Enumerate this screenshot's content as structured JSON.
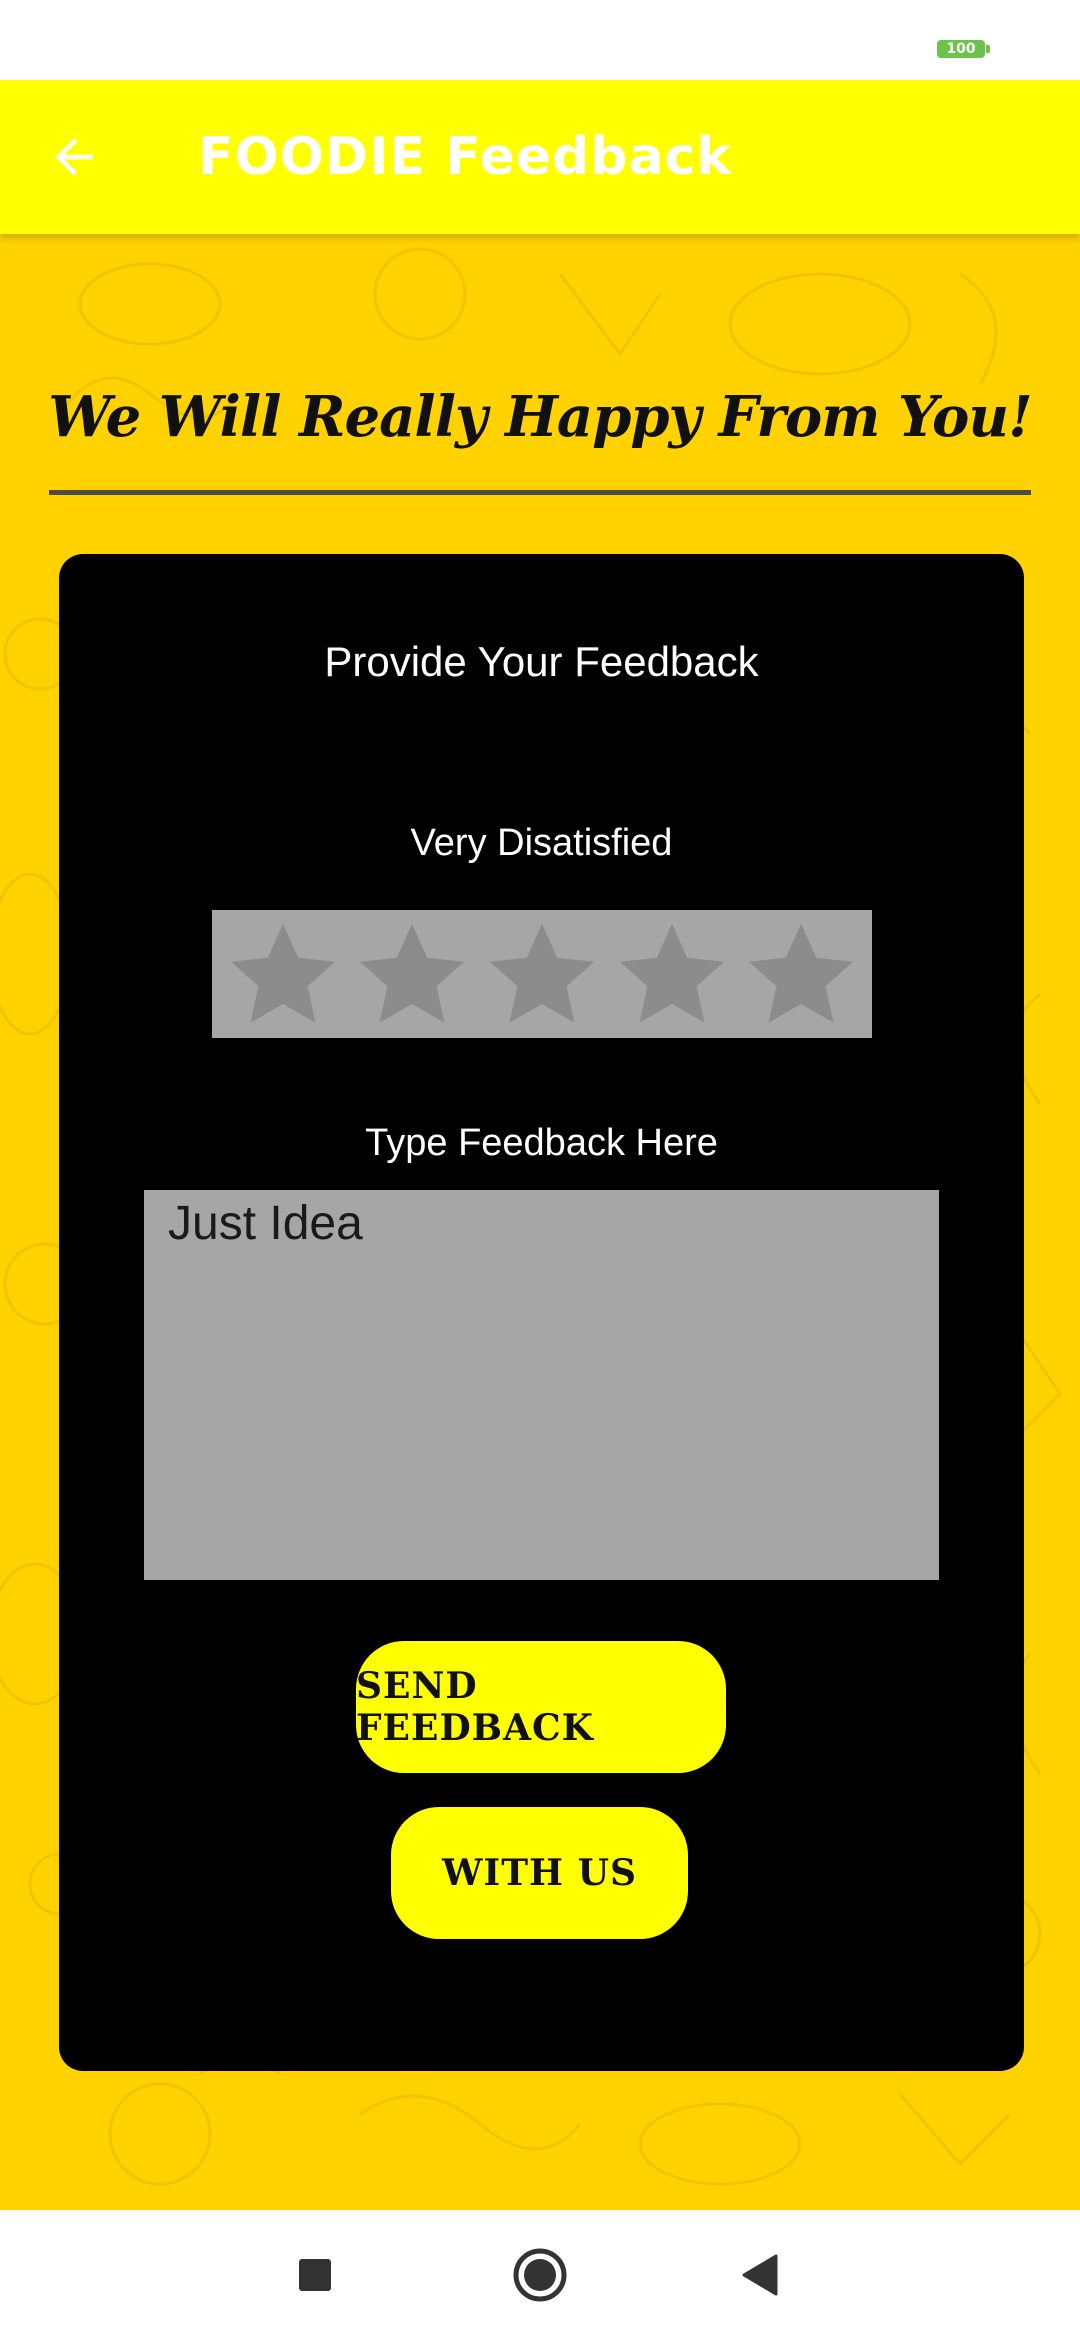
{
  "status_bar": {
    "battery_level": "100"
  },
  "app_bar": {
    "title": "FOODIE Feedback",
    "back_icon": "arrow-left-icon",
    "background_color": "#ffff00"
  },
  "main": {
    "headline": "We Will Really Happy From You!",
    "background_color": "#ffd200",
    "card": {
      "title": "Provide Your Feedback",
      "rating_label": "Very Disatisfied",
      "rating": {
        "value": 0,
        "max": 5,
        "icon": "star-icon"
      },
      "feedback_label": "Type Feedback Here",
      "feedback_value": "Just Idea",
      "send_button_label": "SEND FEEDBACK",
      "with_us_button_label": "WITH US"
    }
  },
  "nav_bar": {
    "recents_icon": "square-icon",
    "home_icon": "circle-icon",
    "back_icon": "triangle-back-icon"
  }
}
